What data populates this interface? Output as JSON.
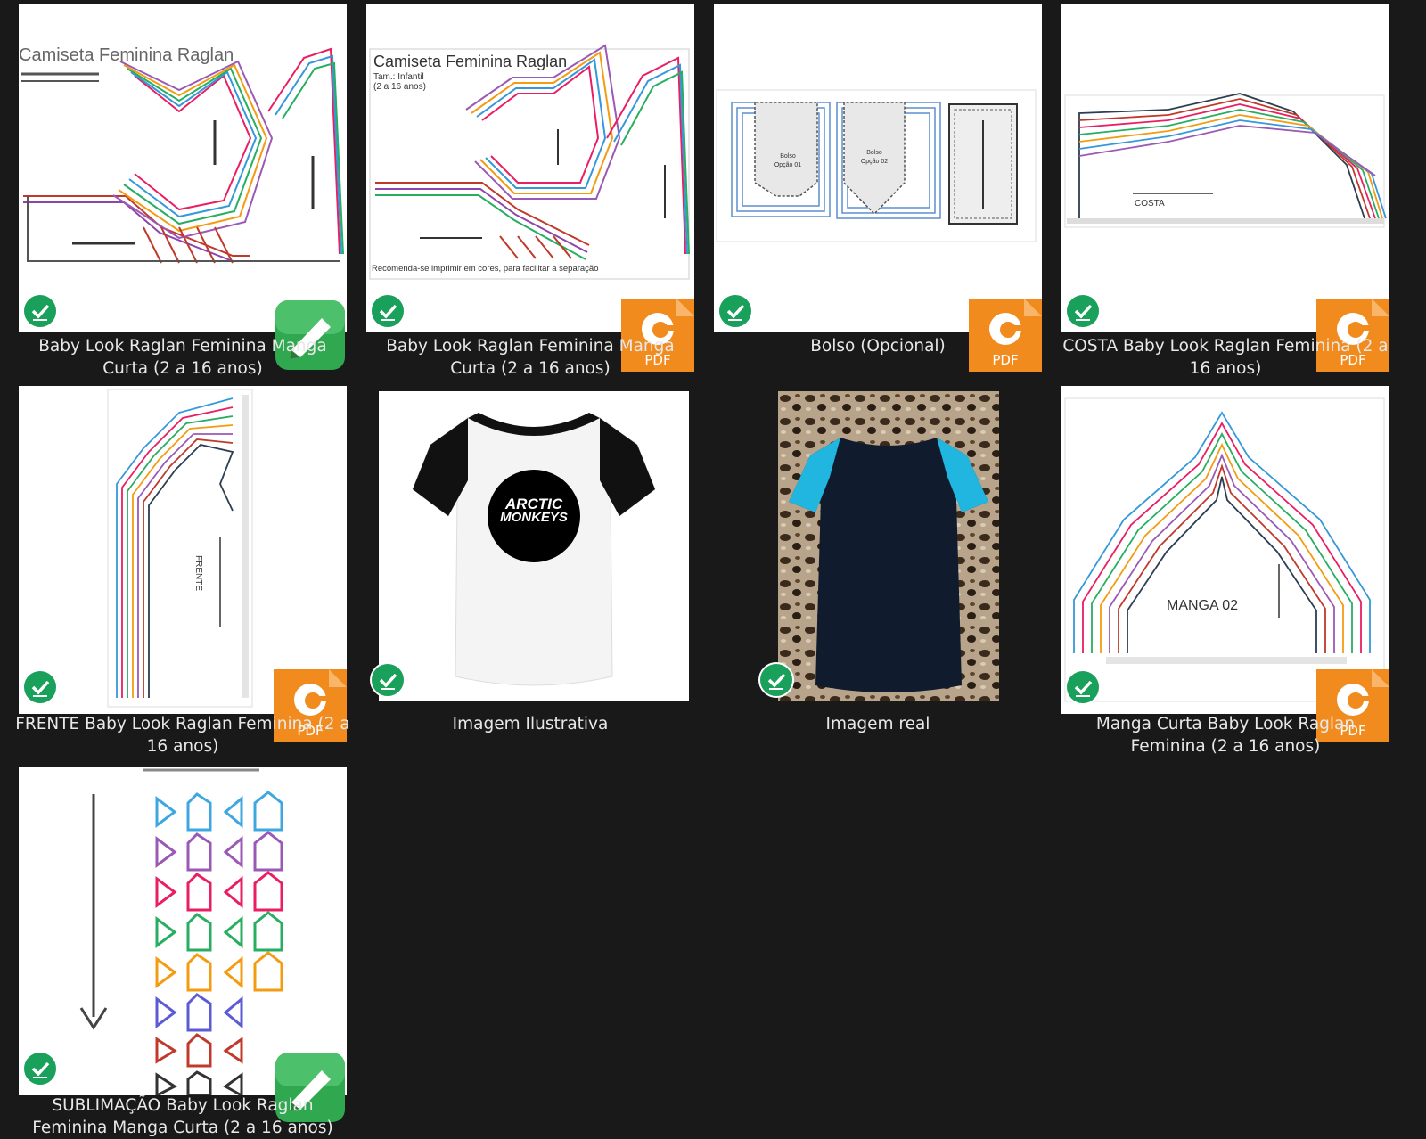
{
  "files": [
    {
      "label": "Baby Look Raglan Feminina Manga Curta (2 a 16 anos)",
      "type": "edit",
      "thumb_title": "Camiseta Feminina Raglan"
    },
    {
      "label": "Baby Look Raglan Feminina Manga Curta (2 a 16 anos)",
      "type": "pdf",
      "thumb_title": "Camiseta Feminina Raglan",
      "thumb_sub1": "Tam.: Infantil",
      "thumb_sub2": "(2 a 16 anos)",
      "thumb_footer": "Recomenda-se imprimir em cores, para facilitar a separação"
    },
    {
      "label": "Bolso (Opcional)",
      "type": "pdf"
    },
    {
      "label": "COSTA Baby Look Raglan Feminina (2 a 16 anos)",
      "type": "pdf",
      "thumb_text": "COSTA"
    },
    {
      "label": "FRENTE Baby Look Raglan Feminina (2 a 16 anos)",
      "type": "pdf",
      "thumb_text": "FRENTE"
    },
    {
      "label": "Imagem Ilustrativa",
      "type": "image",
      "shirt_text1": "ARCTIC",
      "shirt_text2": "MONKEYS"
    },
    {
      "label": "Imagem real",
      "type": "image"
    },
    {
      "label": "Manga Curta Baby Look Raglan Feminina (2 a 16 anos)",
      "type": "pdf",
      "thumb_text": "MANGA 02"
    },
    {
      "label": "SUBLIMAÇÃO Baby Look Raglan Feminina Manga Curta (2 a 16 anos)",
      "type": "edit"
    }
  ],
  "badges": {
    "pdf_label": "PDF"
  },
  "colors": {
    "background": "#191919",
    "check": "#19a05a",
    "pdf": "#f28b1e",
    "edit": "#2fa84f"
  }
}
